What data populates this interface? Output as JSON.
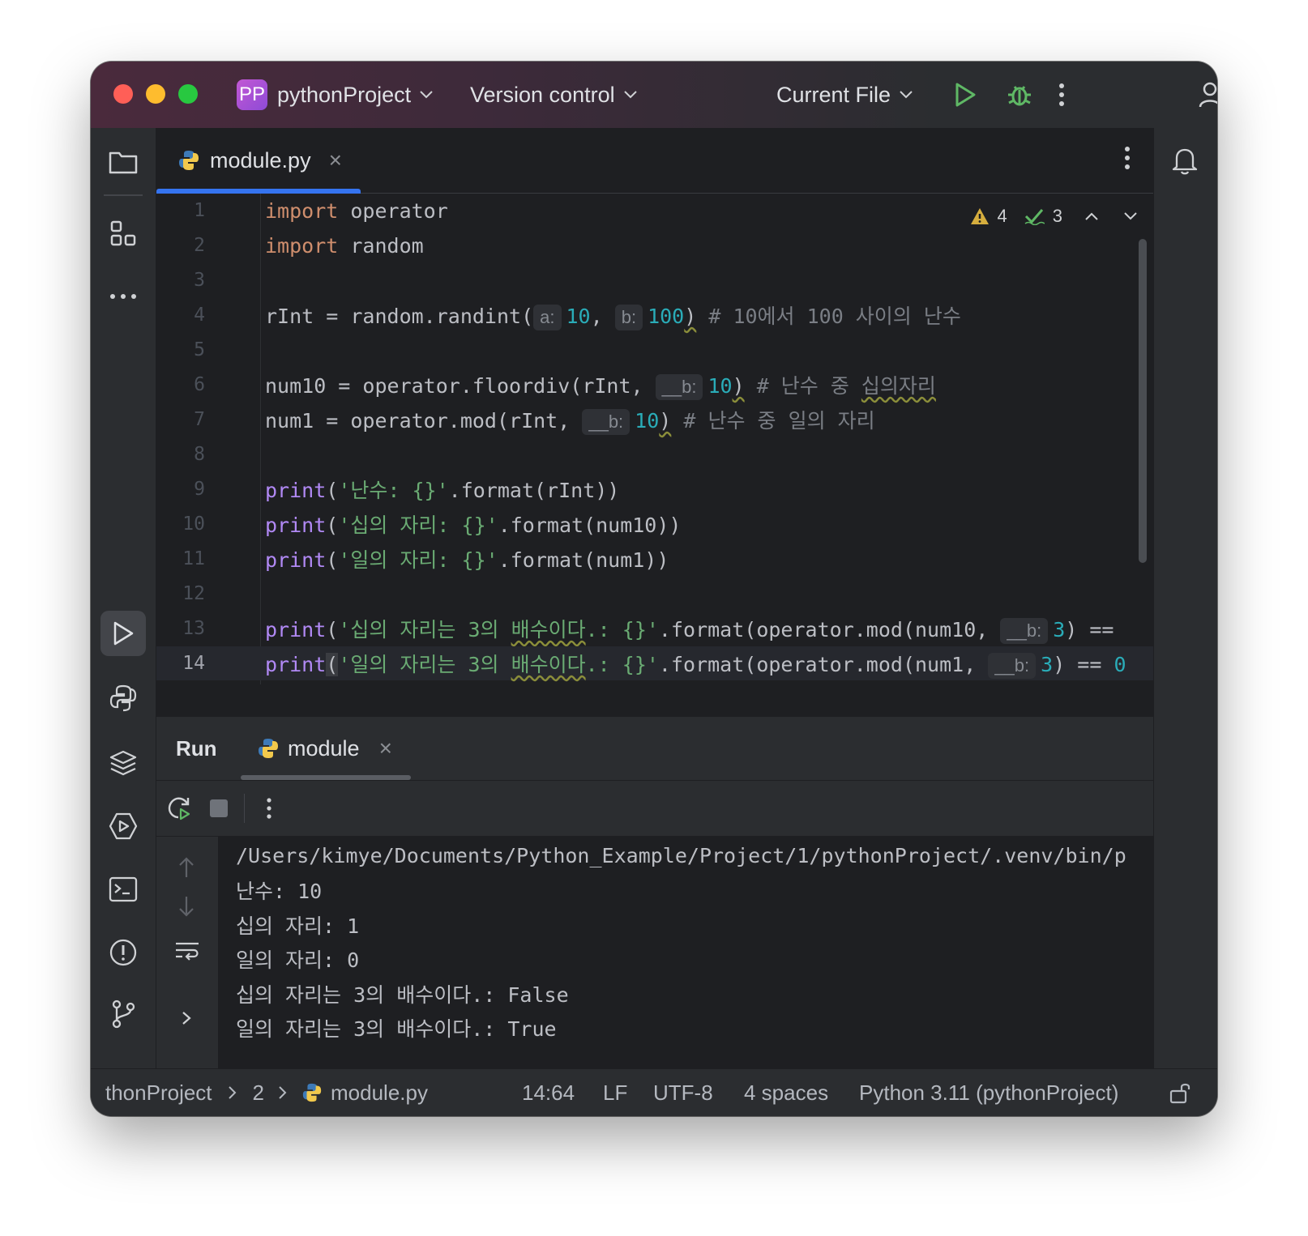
{
  "titlebar": {
    "project_badge": "PP",
    "project_name": "pythonProject",
    "vcs": "Version control",
    "run_config": "Current File"
  },
  "editor": {
    "tab_label": "module.py",
    "inspections": {
      "warnings": "4",
      "weak_warnings": "3"
    },
    "lines": [
      {
        "n": "1"
      },
      {
        "n": "2"
      },
      {
        "n": "3"
      },
      {
        "n": "4"
      },
      {
        "n": "5"
      },
      {
        "n": "6"
      },
      {
        "n": "7"
      },
      {
        "n": "8"
      },
      {
        "n": "9"
      },
      {
        "n": "10"
      },
      {
        "n": "11"
      },
      {
        "n": "12"
      },
      {
        "n": "13"
      },
      {
        "n": "14"
      }
    ],
    "code": {
      "import": "import",
      "operator": " operator",
      "random": " random",
      "l4_a": "rInt = random.randint(",
      "l4_hint_a": "a:",
      "l4_v1": "10",
      "l4_comma": ", ",
      "l4_hint_b": "b:",
      "l4_v2": "100",
      "l4_close": ")",
      "l4_cmt": " # 10에서 100 사이의 난수",
      "l6_a": "num10 = operator.floordiv(rInt, ",
      "hint_b2": "__b:",
      "v10": "10",
      "close": ")",
      "l6_cmt1": " # 난수 중 ",
      "l6_cmt2": "십의자리",
      "l7_a": "num1 = operator.mod(rInt, ",
      "l7_cmt": " # 난수 중 일의 자리",
      "print": "print",
      "paren": "(",
      "l9_str": "'난수: {}'",
      "l9_rest": ".format(rInt))",
      "l10_str": "'십의 자리: {}'",
      "l10_rest": ".format(num10))",
      "l11_str": "'일의 자리: {}'",
      "l11_rest": ".format(num1))",
      "l13_str1": "'십의 자리는 3의 ",
      "l13_str2": "배수이다",
      "l13_str3": ".: {}'",
      "l13_rest": ".format(operator.mod(num10, ",
      "v3": "3",
      "l13_tail": ") ==",
      "l14_str1": "'일의 자리는 3의 ",
      "l14_rest": ".format(operator.mod(num1, ",
      "l14_tail": ") == ",
      "l14_cut": "0"
    }
  },
  "run": {
    "title": "Run",
    "tab_label": "module",
    "output": [
      "/Users/kimye/Documents/Python_Example/Project/1/pythonProject/.venv/bin/p",
      "난수: 10",
      "십의 자리: 1",
      "일의 자리: 0",
      "십의 자리는 3의 배수이다.: False",
      "일의 자리는 3의 배수이다.: True"
    ]
  },
  "status": {
    "crumb_project": "thonProject",
    "crumb_dir": "2",
    "crumb_file": "module.py",
    "position": "14:64",
    "line_sep": "LF",
    "encoding": "UTF-8",
    "indent": "4 spaces",
    "interpreter": "Python 3.11 (pythonProject)"
  },
  "colors": {
    "accent": "#3574f0",
    "keyword": "#cf8e6d",
    "function": "#b189f5",
    "number": "#2aacb8",
    "string": "#6aab73",
    "comment": "#7a7e85"
  }
}
